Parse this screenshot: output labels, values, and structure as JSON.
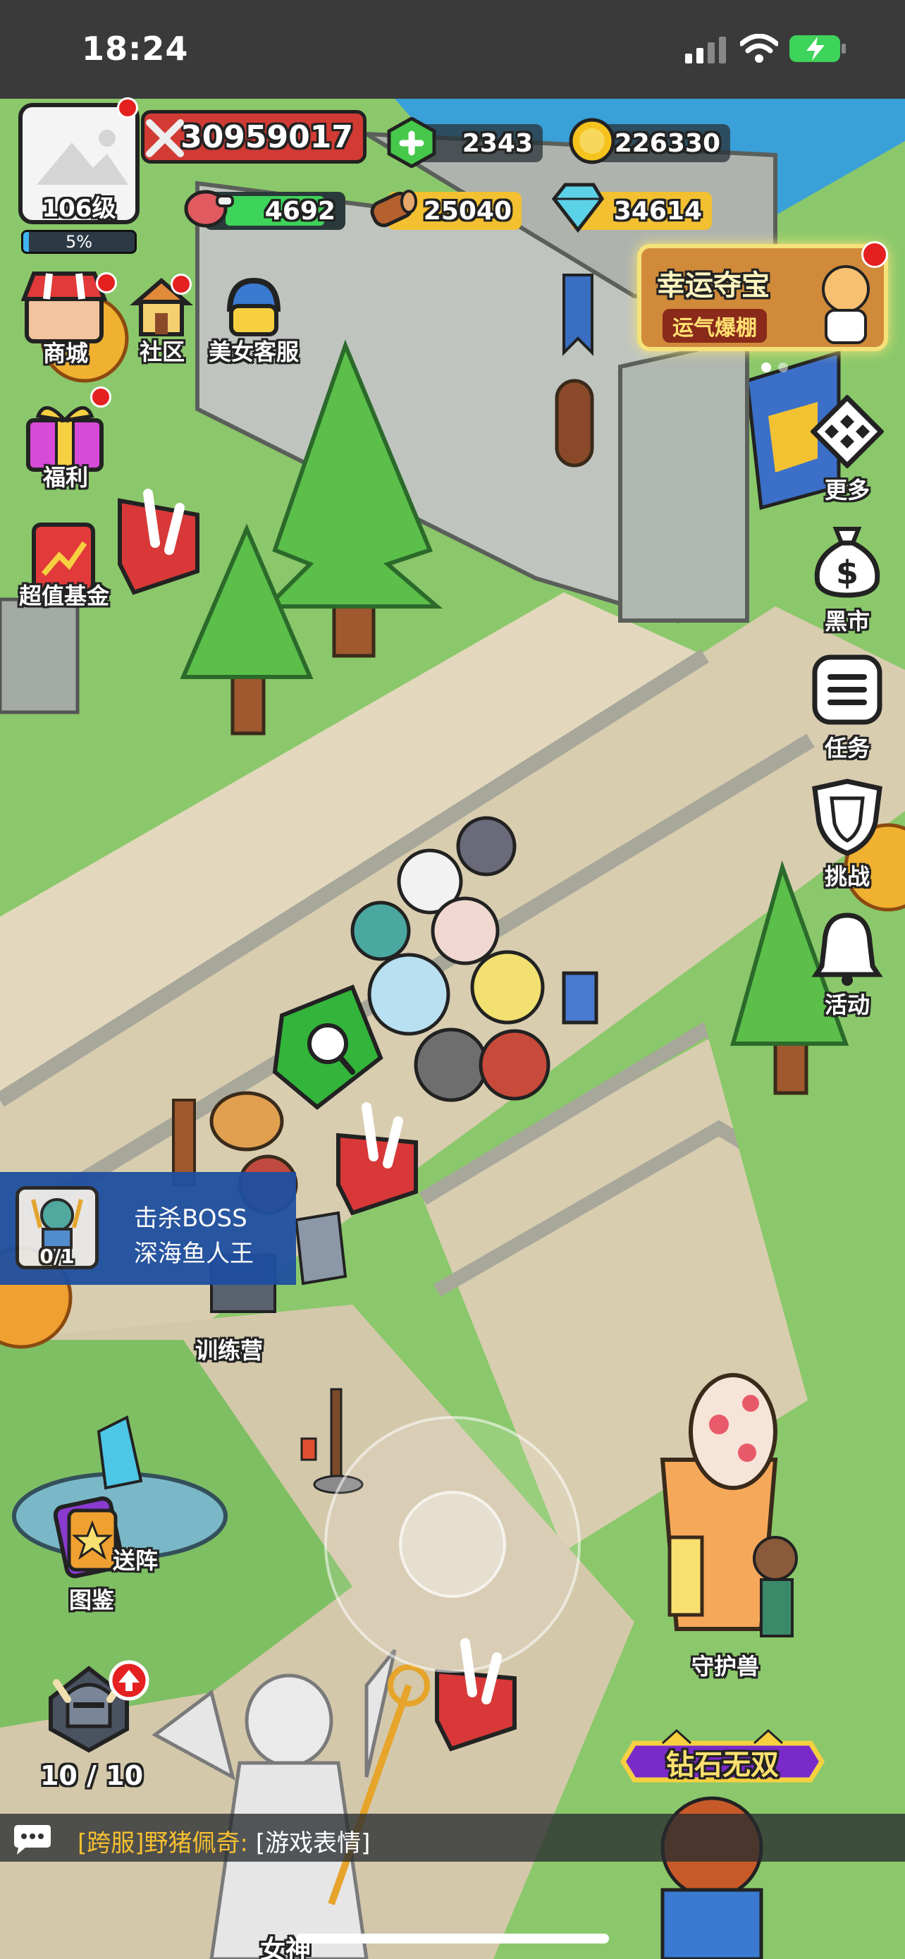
{
  "status_bar": {
    "time": "18:24"
  },
  "player": {
    "level": "106级",
    "exp_percent": "5%",
    "exp_fraction": 0.05
  },
  "resources": {
    "power": "30959017",
    "gems": "2343",
    "gold": "226330",
    "meat": "4692",
    "wood": "25040",
    "crystal": "34614"
  },
  "menu_left": {
    "shop": "商城",
    "community": "社区",
    "service": "美女客服",
    "welfare": "福利",
    "fund": "超值基金"
  },
  "lucky_banner": {
    "title": "幸运夺宝",
    "subtitle": "运气爆棚"
  },
  "menu_right": {
    "more": "更多",
    "black_market": "黑市",
    "tasks": "任务",
    "challenge": "挑战",
    "events": "活动"
  },
  "quest": {
    "progress": "0/1",
    "line1": "击杀BOSS",
    "line2": "深海鱼人王"
  },
  "buildings": {
    "training_camp": "训练营",
    "teleport": "送阵",
    "codex": "图鉴",
    "guardian": "守护兽",
    "goddess": "女神"
  },
  "helmet": {
    "count": "10 / 10"
  },
  "diamond_banner": {
    "text": "钻石无双"
  },
  "chat": {
    "tag": "[跨服]",
    "user": "野猪佩奇:",
    "message": "[游戏表情]"
  },
  "colors": {
    "grass": "#8bc86b",
    "path": "#d9cdb0",
    "wall": "#bfc4bf",
    "red_dot": "#e52020",
    "quest_bg": "#1f4fa0"
  }
}
